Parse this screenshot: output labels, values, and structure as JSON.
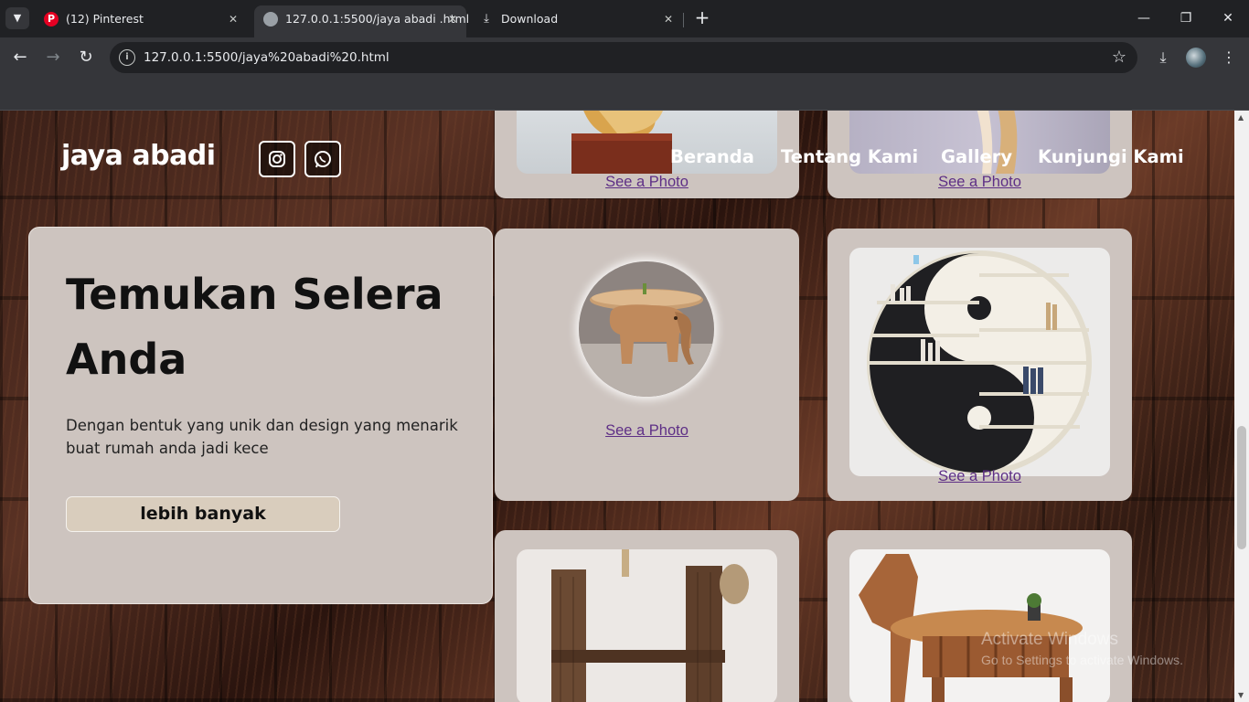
{
  "browser": {
    "tabs": [
      {
        "title": "(12) Pinterest",
        "favicon": "pinterest-icon"
      },
      {
        "title": "127.0.0.1:5500/jaya abadi .html",
        "favicon": "globe-icon"
      },
      {
        "title": "Download",
        "favicon": "download-icon"
      }
    ],
    "address": "127.0.0.1:5500/jaya%20abadi%20.html"
  },
  "site": {
    "brand": "jaya abadi",
    "social": [
      {
        "icon": "instagram-icon"
      },
      {
        "icon": "whatsapp-icon"
      }
    ],
    "nav": [
      "Beranda",
      "Tentang Kami",
      "Gallery",
      "Kunjungi Kami"
    ],
    "hero": {
      "title": "Temukan Selera Anda",
      "description": "Dengan bentuk yang unik dan design yang menarik buat rumah anda jadi kece",
      "button": "lebih banyak"
    },
    "gallery": {
      "link_label": "See a Photo",
      "items": [
        {
          "photo": "wooden-sculpture-photo"
        },
        {
          "photo": "wooden-art-photo"
        },
        {
          "photo": "elephant-table-photo"
        },
        {
          "photo": "yin-yang-bookshelf-photo"
        },
        {
          "photo": "rope-wall-shelf-photo"
        },
        {
          "photo": "horse-desk-photo"
        }
      ]
    }
  },
  "os": {
    "watermark_title": "Activate Windows",
    "watermark_sub": "Go to Settings to activate Windows."
  }
}
